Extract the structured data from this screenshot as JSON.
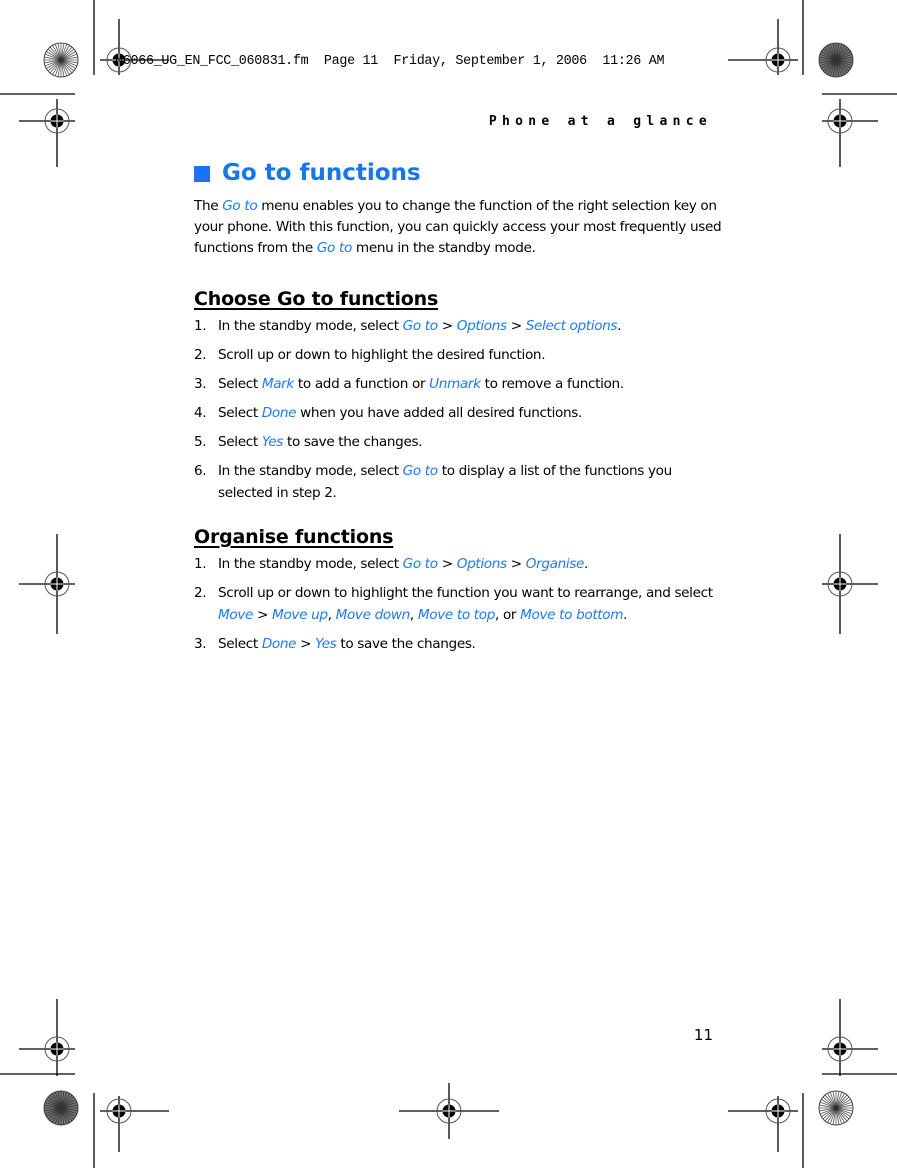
{
  "slug": "N6066_UG_EN_FCC_060831.fm  Page 11  Friday, September 1, 2006  11:26 AM",
  "running_head": "Phone at a glance",
  "page_number": "11",
  "accent_color": "#1a7cf7",
  "section": {
    "title": "Go to functions",
    "bullet_icon": "blue-square-icon",
    "intro": [
      {
        "t": "The "
      },
      {
        "t": "Go to",
        "m": true
      },
      {
        "t": " menu enables you to change the function of the right selection key on your phone. With this function, you can quickly access your most frequently used functions from the "
      },
      {
        "t": "Go to",
        "m": true
      },
      {
        "t": " menu in the standby mode."
      }
    ]
  },
  "subsections": [
    {
      "title": "Choose Go to functions",
      "steps": [
        {
          "num": "1.",
          "parts": [
            {
              "t": "In the standby mode, select "
            },
            {
              "t": "Go to",
              "m": true
            },
            {
              "t": " > "
            },
            {
              "t": "Options",
              "m": true
            },
            {
              "t": " > "
            },
            {
              "t": "Select options",
              "m": true
            },
            {
              "t": "."
            }
          ]
        },
        {
          "num": "2.",
          "parts": [
            {
              "t": "Scroll up or down to highlight the desired function."
            }
          ]
        },
        {
          "num": "3.",
          "parts": [
            {
              "t": "Select "
            },
            {
              "t": "Mark",
              "m": true
            },
            {
              "t": " to add a function or "
            },
            {
              "t": "Unmark",
              "m": true
            },
            {
              "t": " to remove a function."
            }
          ]
        },
        {
          "num": "4.",
          "parts": [
            {
              "t": "Select "
            },
            {
              "t": "Done",
              "m": true
            },
            {
              "t": " when you have added all desired functions."
            }
          ]
        },
        {
          "num": "5.",
          "parts": [
            {
              "t": "Select "
            },
            {
              "t": "Yes",
              "m": true
            },
            {
              "t": " to save the changes."
            }
          ]
        },
        {
          "num": "6.",
          "parts": [
            {
              "t": "In the standby mode, select "
            },
            {
              "t": "Go to",
              "m": true
            },
            {
              "t": " to display a list of the functions you selected in step 2."
            }
          ]
        }
      ]
    },
    {
      "title": "Organise functions",
      "steps": [
        {
          "num": "1.",
          "parts": [
            {
              "t": "In the standby mode, select "
            },
            {
              "t": "Go to",
              "m": true
            },
            {
              "t": " > "
            },
            {
              "t": "Options",
              "m": true
            },
            {
              "t": " > "
            },
            {
              "t": "Organise",
              "m": true
            },
            {
              "t": "."
            }
          ]
        },
        {
          "num": "2.",
          "parts": [
            {
              "t": "Scroll up or down to highlight the function you want to rearrange, and select "
            },
            {
              "t": "Move",
              "m": true
            },
            {
              "t": " > "
            },
            {
              "t": "Move up",
              "m": true
            },
            {
              "t": ", "
            },
            {
              "t": "Move down",
              "m": true
            },
            {
              "t": ", "
            },
            {
              "t": "Move to top",
              "m": true
            },
            {
              "t": ", or "
            },
            {
              "t": "Move to bottom",
              "m": true
            },
            {
              "t": "."
            }
          ]
        },
        {
          "num": "3.",
          "parts": [
            {
              "t": "Select "
            },
            {
              "t": "Done",
              "m": true
            },
            {
              "t": " > "
            },
            {
              "t": "Yes",
              "m": true
            },
            {
              "t": " to save the changes."
            }
          ]
        }
      ]
    }
  ]
}
